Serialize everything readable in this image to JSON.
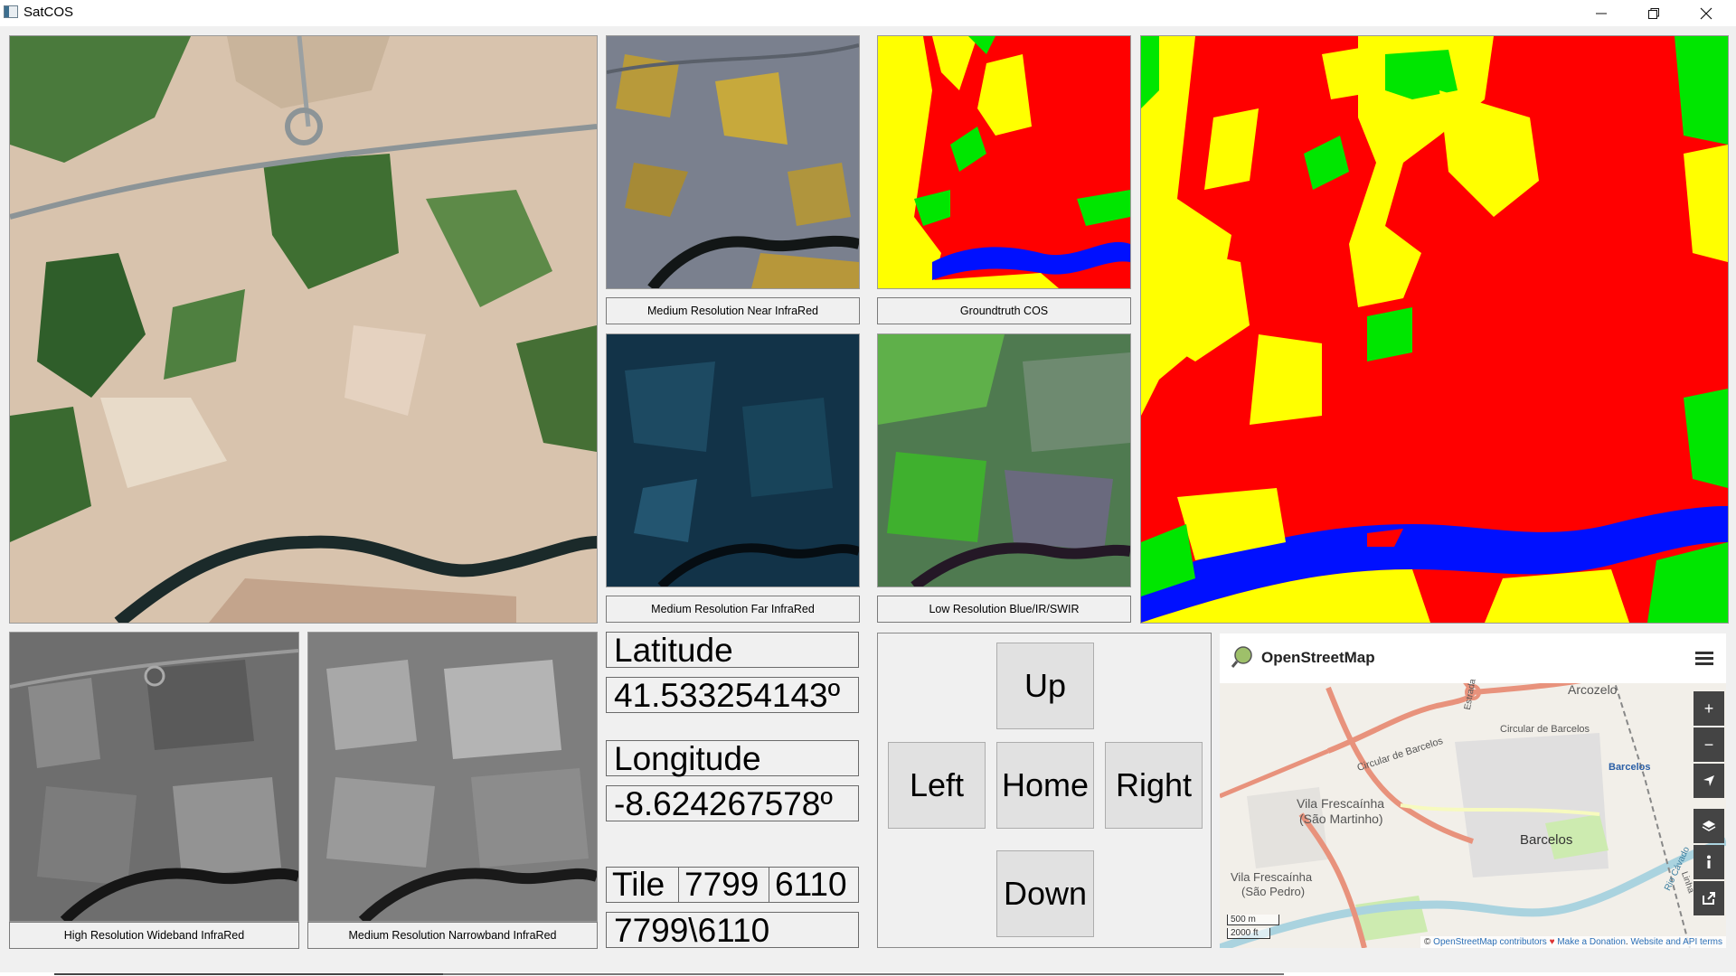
{
  "window": {
    "title": "SatCOS",
    "minimize": "—",
    "restore": "❐",
    "close": "✕"
  },
  "captions": {
    "nir": "Medium Resolution Near InfraRed",
    "cos": "Groundtruth COS",
    "fir": "Medium Resolution Far InfraRed",
    "low": "Low Resolution Blue/IR/SWIR",
    "hrw": "High Resolution Wideband InfraRed",
    "mrn": "Medium Resolution Narrowband InfraRed"
  },
  "coords": {
    "lat_label": "Latitude",
    "lat_value": "41.533254143º",
    "lon_label": "Longitude",
    "lon_value": "-8.624267578º"
  },
  "tile": {
    "label": "Tile",
    "x": "7799",
    "y": "6110",
    "path": "7799\\6110"
  },
  "nav": {
    "up": "Up",
    "left": "Left",
    "home": "Home",
    "right": "Right",
    "down": "Down"
  },
  "map": {
    "brand": "OpenStreetMap",
    "labels": {
      "arcozelo": "Arcozelo",
      "circ1": "Circular de Barcelos",
      "circ2": "Circular de Barcelos",
      "estrada": "Estrada",
      "barcelos_small": "Barcelos",
      "vila1": "Vila Frescaínha",
      "vila1b": "(São Martinho)",
      "barcelos": "Barcelos",
      "vila2": "Vila Frescaínha",
      "vila2b": "(São Pedro)",
      "rio": "Rio Cávado",
      "linha": "Linha"
    },
    "scale_m": "500 m",
    "scale_ft": "2000 ft",
    "attrib_prefix": "© ",
    "attrib_osm": "OpenStreetMap contributors",
    "attrib_heart": " ♥ ",
    "attrib_donate": "Make a Donation",
    "attrib_mid": ". ",
    "attrib_api": "Website and API terms"
  },
  "colors": {
    "cos_red": "#ff0000",
    "cos_yellow": "#ffff00",
    "cos_green": "#00e600",
    "cos_blue": "#0010ff"
  }
}
